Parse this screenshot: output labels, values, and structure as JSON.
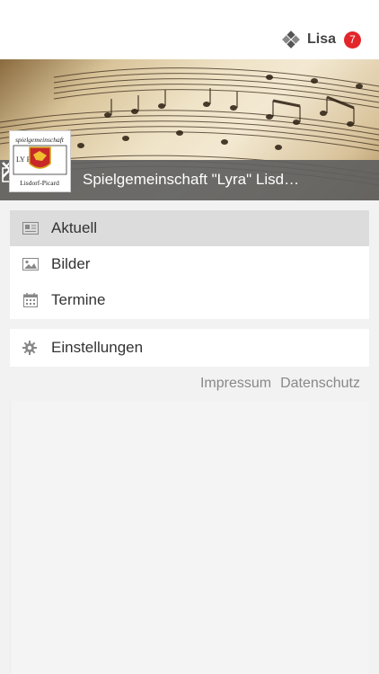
{
  "header": {
    "user_name": "Lisa",
    "notification_count": "7",
    "app_icon": "diamond-logo-icon"
  },
  "banner": {
    "title": "Spielgemeinschaft \"Lyra\" Lisdorf-Picard",
    "logo_top_text": "spielgemeinschaft",
    "logo_letters": "LY RA",
    "logo_bottom_text": "Lisdorf-Picard"
  },
  "menu": {
    "items": [
      {
        "label": "Aktuell",
        "icon": "newspaper-icon",
        "active": true
      },
      {
        "label": "Bilder",
        "icon": "image-icon",
        "active": false
      },
      {
        "label": "Termine",
        "icon": "calendar-icon",
        "active": false
      }
    ],
    "settings_label": "Einstellungen"
  },
  "footer": {
    "impressum": "Impressum",
    "datenschutz": "Datenschutz"
  },
  "colors": {
    "badge": "#e2262a",
    "title_bar": "#5f5f5f",
    "active_item": "#dcdcdc"
  }
}
